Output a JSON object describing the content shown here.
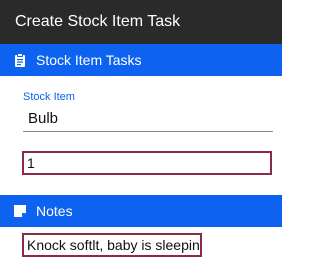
{
  "app": {
    "title": "Create Stock Item Task"
  },
  "sections": {
    "tasks": {
      "label": "Stock Item Tasks",
      "icon": "clipboard-icon"
    },
    "notes": {
      "label": "Notes",
      "icon": "note-icon"
    }
  },
  "form": {
    "stock_item": {
      "label": "Stock Item",
      "value": "Bulb"
    },
    "quantity": {
      "value": "1"
    },
    "notes": {
      "value": "Knock softlt, baby is sleeping"
    }
  },
  "colors": {
    "titlebar": "#2a2a2a",
    "accent": "#0d62f0",
    "highlight_border": "#8b2a4e"
  }
}
